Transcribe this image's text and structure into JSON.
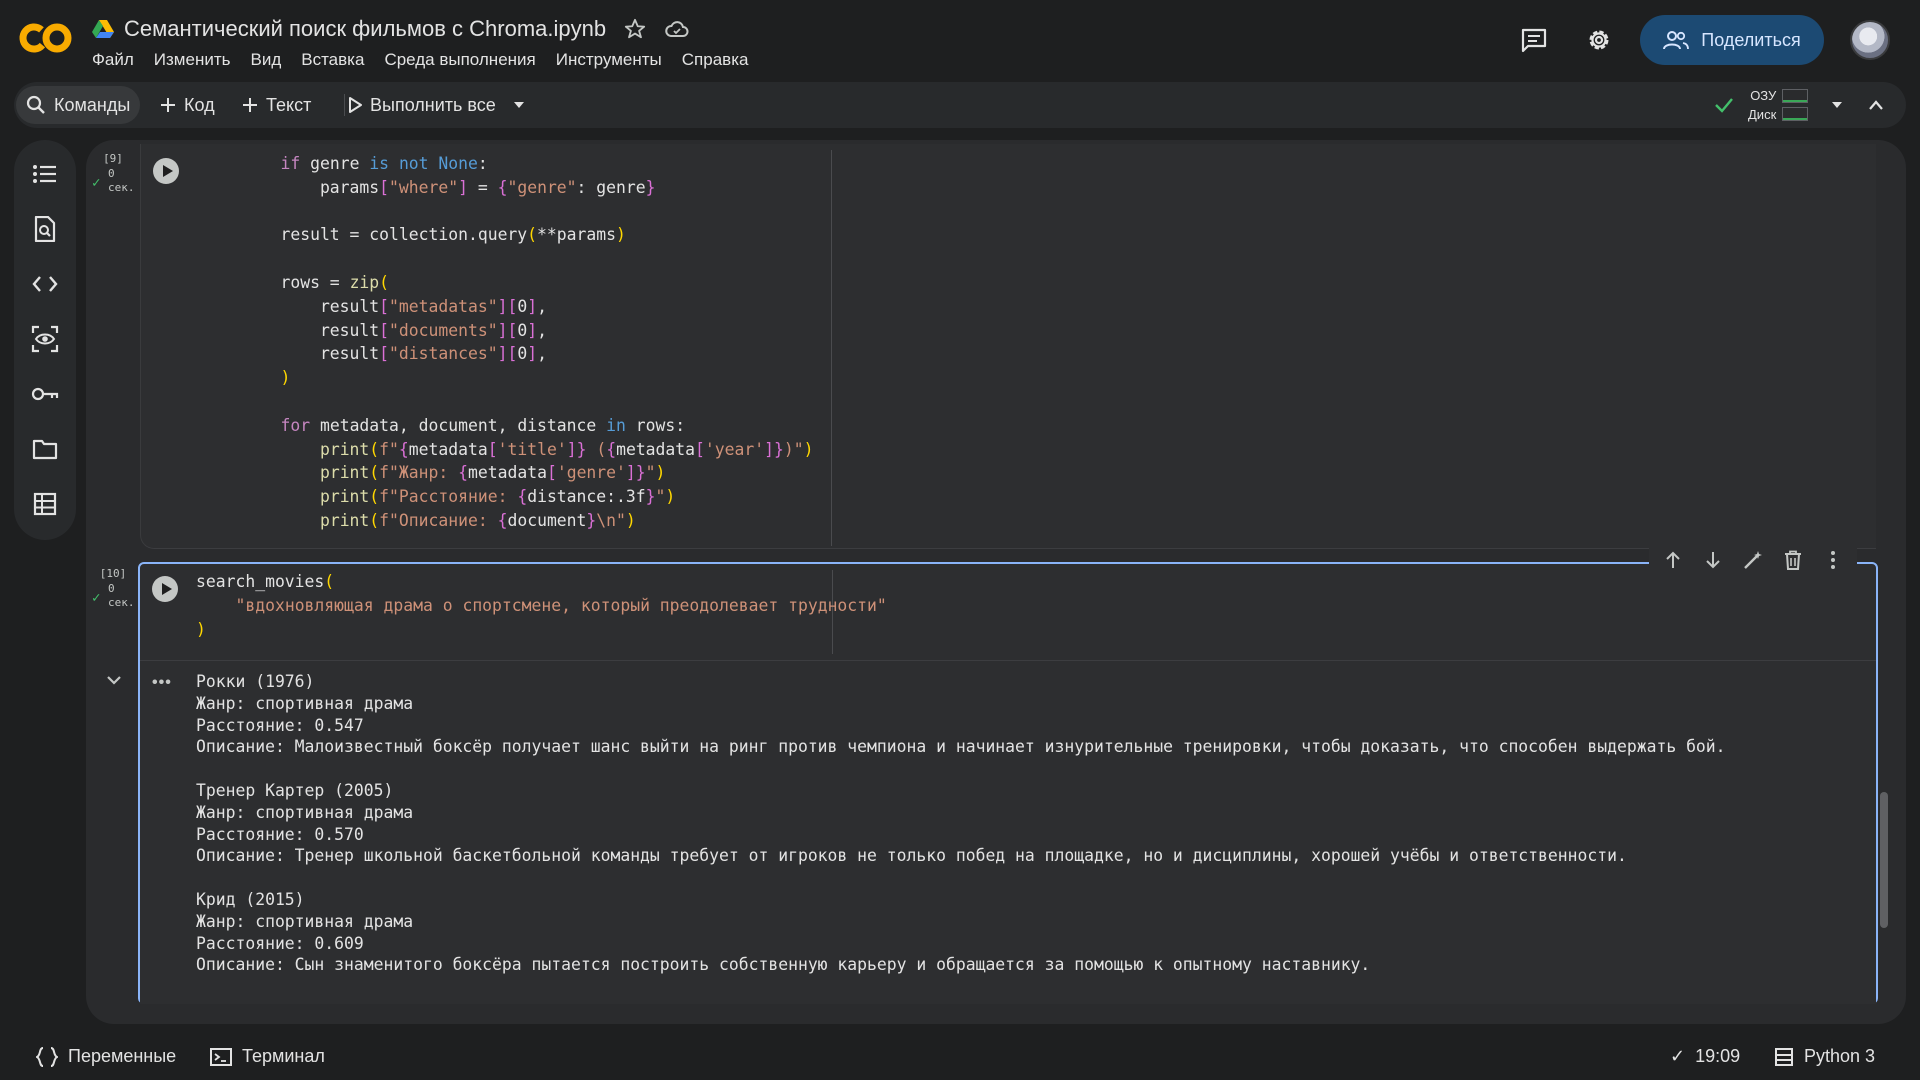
{
  "header": {
    "logo_text": "CO",
    "title": "Семантический поиск фильмов с Chroma.ipynb",
    "menu": [
      "Файл",
      "Изменить",
      "Вид",
      "Вставка",
      "Среда выполнения",
      "Инструменты",
      "Справка"
    ],
    "share_label": "Поделиться",
    "icons": [
      "google-drive-icon",
      "star-icon",
      "cloud-icon",
      "comments-icon",
      "gear-icon",
      "people-icon",
      "avatar"
    ]
  },
  "toolbar": {
    "commands_label": "Команды",
    "add_code_label": "Код",
    "add_text_label": "Текст",
    "run_all_label": "Выполнить все",
    "ram_label": "ОЗУ",
    "disk_label": "Диск",
    "connected": true
  },
  "left_rail": {
    "icons": [
      "table-of-contents-icon",
      "find-replace-icon",
      "code-snippets-icon",
      "variable-inspector-icon",
      "secrets-key-icon",
      "files-folder-icon",
      "data-table-icon"
    ]
  },
  "cells": [
    {
      "exec_count": "[9]",
      "status_check": "✓",
      "time_value": "0",
      "time_unit": "сек."
    },
    {
      "exec_count": "[10]",
      "status_check": "✓",
      "time_value": "0",
      "time_unit": "сек.",
      "output": {
        "menu_label": "•••",
        "lines": [
          "Рокки (1976)",
          "Жанр: спортивная драма",
          "Расстояние: 0.547",
          "Описание: Малоизвестный боксёр получает шанс выйти на ринг против чемпиона и начинает изнурительные тренировки, чтобы доказать, что способен выдержать бой.",
          "",
          "Тренер Картер (2005)",
          "Жанр: спортивная драма",
          "Расстояние: 0.570",
          "Описание: Тренер школьной баскетбольной команды требует от игроков не только побед на площадке, но и дисциплины, хорошей учёбы и ответственности.",
          "",
          "Крид (2015)",
          "Жанр: спортивная драма",
          "Расстояние: 0.609",
          "Описание: Сын знаменитого боксёра пытается построить собственную карьеру и обращается за помощью к опытному наставнику."
        ]
      }
    }
  ],
  "status_bar": {
    "variables_label": "Переменные",
    "terminal_label": "Терминал",
    "check": "✓",
    "time": "19:09",
    "runtime_label": "Python 3"
  },
  "colors": {
    "background": "#1e1f20",
    "panel": "#2a2b2d",
    "cell": "#2d2e30",
    "focus_border": "#8ab4f8",
    "share_button": "#1c4a73",
    "logo_orange": "#f9ab00",
    "success_green": "#43c06b"
  }
}
